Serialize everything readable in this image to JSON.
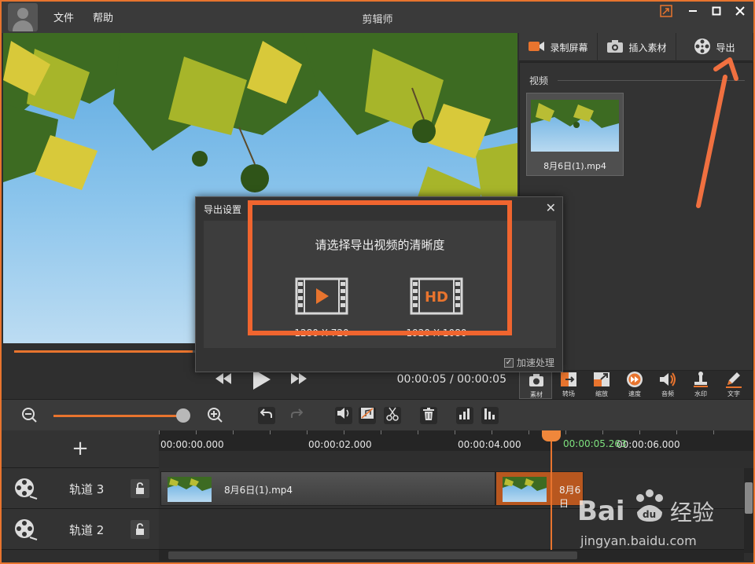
{
  "app": {
    "title": "剪辑师",
    "menu": [
      "文件",
      "帮助"
    ]
  },
  "colors": {
    "accent": "#e8742e",
    "highlight_box": "#f0652f",
    "playhead_time": "#7ee27e"
  },
  "player": {
    "current_time": "00:00:05",
    "total_time": "00:00:05",
    "time_display": "00:00:05 / 00:00:05",
    "progress_fraction": 0.36
  },
  "right_panel": {
    "tabs": [
      {
        "label": "录制屏幕",
        "icon": "camera-record-icon"
      },
      {
        "label": "插入素材",
        "icon": "photo-camera-icon"
      },
      {
        "label": "导出",
        "icon": "film-reel-icon"
      }
    ],
    "section_label": "视频",
    "media_items": [
      {
        "name": "8月6日(1).mp4"
      }
    ],
    "tools": [
      {
        "label": "素材",
        "icon": "camera-icon"
      },
      {
        "label": "转场",
        "icon": "transition-icon"
      },
      {
        "label": "缩放",
        "icon": "scale-icon"
      },
      {
        "label": "速度",
        "icon": "speed-icon"
      },
      {
        "label": "音频",
        "icon": "audio-icon"
      },
      {
        "label": "水印",
        "icon": "watermark-stamp-icon"
      },
      {
        "label": "文字",
        "icon": "pencil-icon"
      }
    ]
  },
  "toolbar": {
    "zoom_level": 0.95
  },
  "timeline": {
    "add_label": "+",
    "ruler_labels": [
      "00:00:00.000",
      "00:00:02.000",
      "00:00:04.000",
      "00:00:06.000"
    ],
    "playhead_time": "00:00:05.263",
    "tracks": [
      {
        "name": "轨道 3",
        "clips": [
          {
            "name": "8月6日(1).mp4"
          },
          {
            "name": "8月6日"
          }
        ]
      },
      {
        "name": "轨道 2",
        "clips": []
      }
    ]
  },
  "export_dialog": {
    "title": "导出设置",
    "close": "✕",
    "prompt": "请选择导出视频的清晰度",
    "options": [
      {
        "label": "1280 X 720",
        "icon": "play-film-icon"
      },
      {
        "label": "1920 X 1080",
        "icon": "hd-film-icon",
        "badge": "HD"
      }
    ],
    "accelerate_label": "加速处理",
    "accelerate_checked": true,
    "check_mark": "✓"
  },
  "watermark": {
    "brand": "Bai",
    "brand_mid": "du",
    "suffix": "经验",
    "url": "jingyan.baidu.com"
  }
}
